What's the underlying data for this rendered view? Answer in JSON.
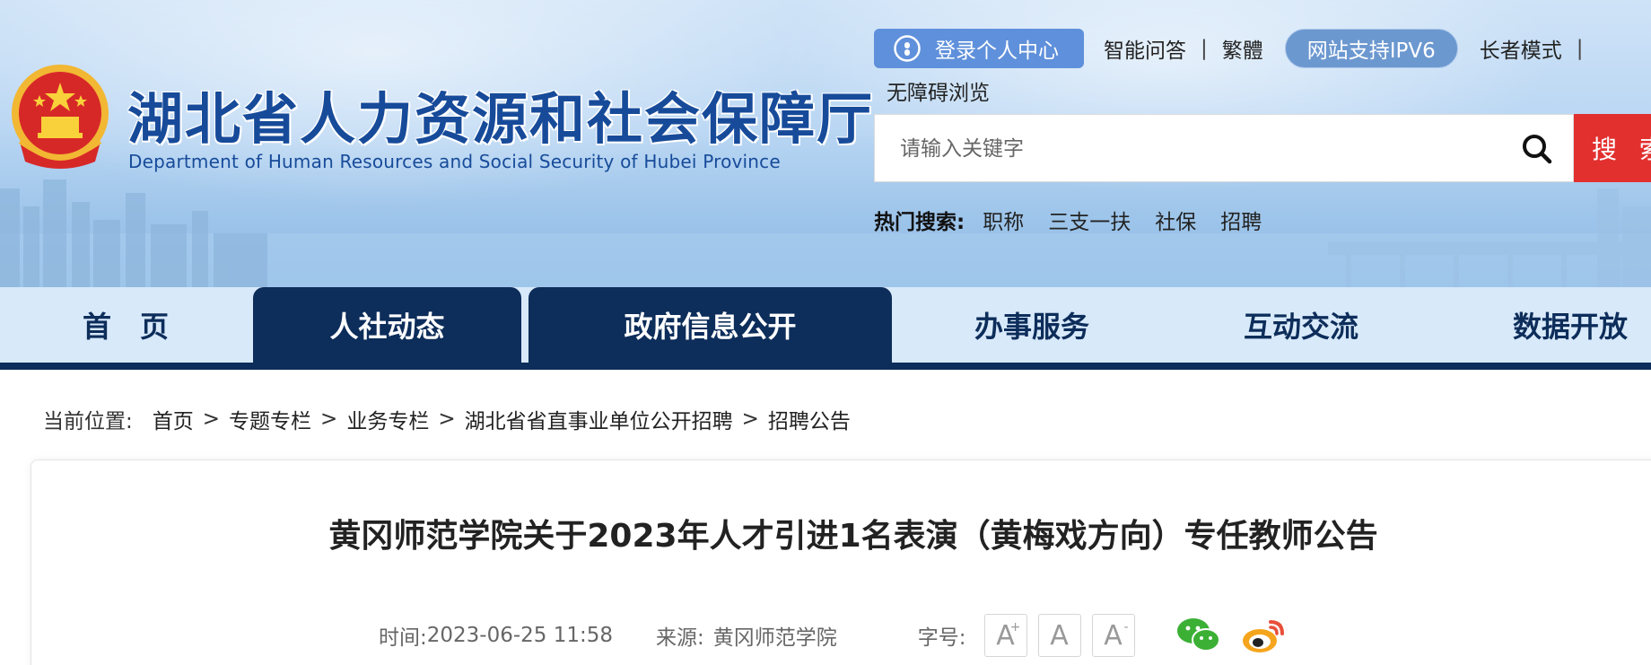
{
  "header": {
    "title": "湖北省人力资源和社会保障厅",
    "subtitle": "Department of Human Resources and Social Security of Hubei Province",
    "emblem_icon": "national-emblem-icon"
  },
  "toplinks": {
    "login": "登录个人中心",
    "smart_qa": "智能问答",
    "traditional": "繁體",
    "ipv6": "网站支持IPV6",
    "elder_mode": "长者模式",
    "accessible": "无障碍浏览"
  },
  "search": {
    "placeholder": "请输入关键字",
    "button": "搜 索",
    "hot_label": "热门搜索:",
    "hot_items": [
      "职称",
      "三支一扶",
      "社保",
      "招聘"
    ]
  },
  "nav": {
    "items": [
      "首　页",
      "人社动态",
      "政府信息公开",
      "办事服务",
      "互动交流",
      "数据开放"
    ]
  },
  "breadcrumb": {
    "label": "当前位置:",
    "items": [
      "首页",
      "专题专栏",
      "业务专栏",
      "湖北省省直事业单位公开招聘",
      "招聘公告"
    ],
    "separator": ">"
  },
  "article": {
    "title": "黄冈师范学院关于2023年人才引进1名表演（黄梅戏方向）专任教师公告",
    "time_label": "时间:",
    "time": "2023-06-25 11:58",
    "source_label": "来源:",
    "source": "黄冈师范学院",
    "font_size_label": "字号:",
    "font_sizes": [
      "A",
      "A",
      "A"
    ],
    "font_size_marks": [
      "+",
      "",
      "-"
    ]
  },
  "colors": {
    "nav_dark": "#0d2d5a",
    "title_blue": "#174b9a",
    "search_red": "#e2302f",
    "login_blue": "#5f90db"
  }
}
